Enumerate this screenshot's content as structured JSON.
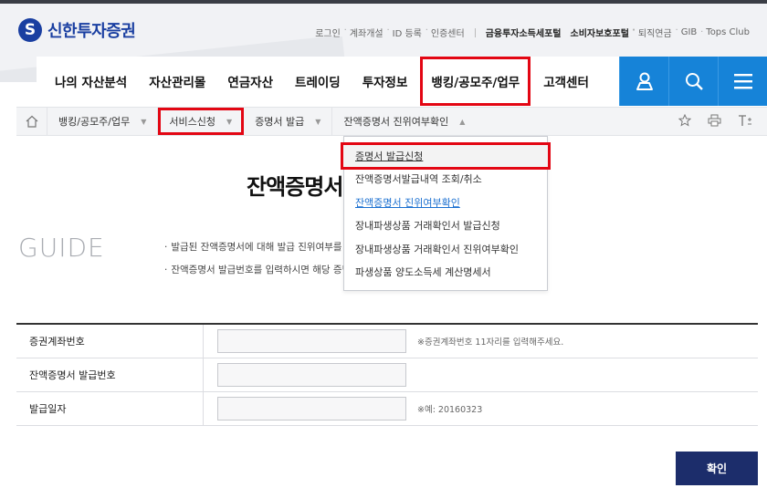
{
  "brand": {
    "name": "신한투자증권",
    "color": "#1a3fa1"
  },
  "utility_links": [
    "로그인",
    "계좌개설",
    "ID 등록",
    "인증센터",
    "금융투자소득세포털",
    "소비자보호포털",
    "퇴직연금",
    "GIB",
    "Tops Club"
  ],
  "gnb": {
    "items": [
      "나의 자산분석",
      "자산관리몰",
      "연금자산",
      "트레이딩",
      "투자정보",
      "뱅킹/공모주/업무",
      "고객센터"
    ],
    "active_item": "뱅킹/공모주/업무",
    "icons": [
      "user-icon",
      "search-icon",
      "menu-icon"
    ],
    "icon_bg": "#1683d8"
  },
  "breadcrumb": {
    "items": [
      "뱅킹/공모주/업무",
      "서비스신청",
      "증명서 발급",
      "잔액증명서 진위여부확인"
    ],
    "tools": [
      "star-icon",
      "print-icon",
      "text-size-icon"
    ]
  },
  "dropdown": {
    "items": [
      "증명서 발급신청",
      "잔액증명서발급내역 조회/취소",
      "잔액증명서 진위여부확인",
      "장내파생상품 거래확인서 발급신청",
      "장내파생상품 거래확인서 진위여부확인",
      "파생상품 양도소득세 계산명세서"
    ]
  },
  "page": {
    "title": "잔액증명서 진위여부확인"
  },
  "guide": {
    "label": "GUIDE",
    "lines": [
      "발급된 잔액증명서에 대해 발급 진위여부를 확인하실 수 있습니다.",
      "잔액증명서 발급번호를 입력하시면 해당 증명서의 진위여부를 확인하실 수 있습니다."
    ]
  },
  "form": {
    "rows": [
      {
        "label": "증권계좌번호",
        "value": "",
        "hint": "※증권계좌번호 11자리를 입력해주세요."
      },
      {
        "label": "잔액증명서 발급번호",
        "value": "",
        "hint": ""
      },
      {
        "label": "발급일자",
        "value": "",
        "hint": "※예: 20160323"
      }
    ]
  },
  "confirm_button": {
    "label": "확인",
    "color": "#1c2d6b"
  },
  "highlight_color": "#e30613"
}
